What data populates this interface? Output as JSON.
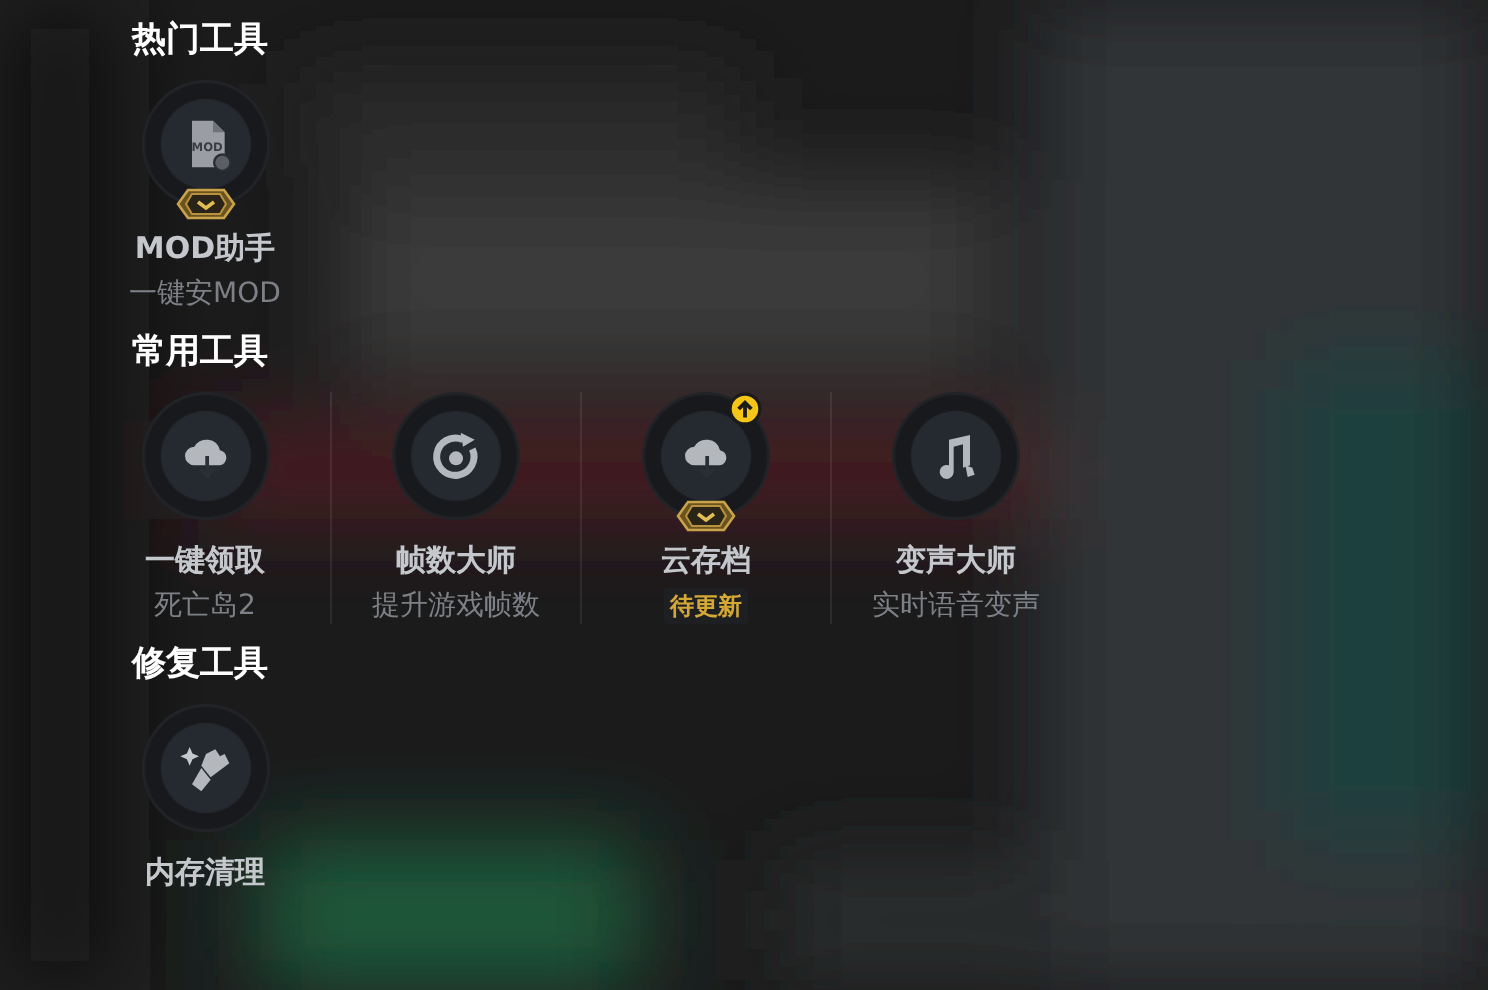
{
  "sections": [
    {
      "title": "热门工具",
      "tools": [
        {
          "kind": "mod",
          "icon_text": "MOD",
          "name": "MOD助手",
          "subtitle": "一键安MOD",
          "vip": true,
          "update": false
        }
      ]
    },
    {
      "title": "常用工具",
      "tools": [
        {
          "kind": "cloud",
          "name": "一键领取",
          "subtitle": "死亡岛2",
          "vip": false,
          "update": false
        },
        {
          "kind": "speed",
          "name": "帧数大师",
          "subtitle": "提升游戏帧数",
          "vip": false,
          "update": false
        },
        {
          "kind": "cloud",
          "name": "云存档",
          "status": "待更新",
          "vip": true,
          "update": true
        },
        {
          "kind": "music",
          "name": "变声大师",
          "subtitle": "实时语音变声",
          "vip": false,
          "update": false
        }
      ]
    },
    {
      "title": "修复工具",
      "tools": [
        {
          "kind": "brush",
          "name": "内存清理",
          "vip": false,
          "update": false
        }
      ]
    }
  ]
}
